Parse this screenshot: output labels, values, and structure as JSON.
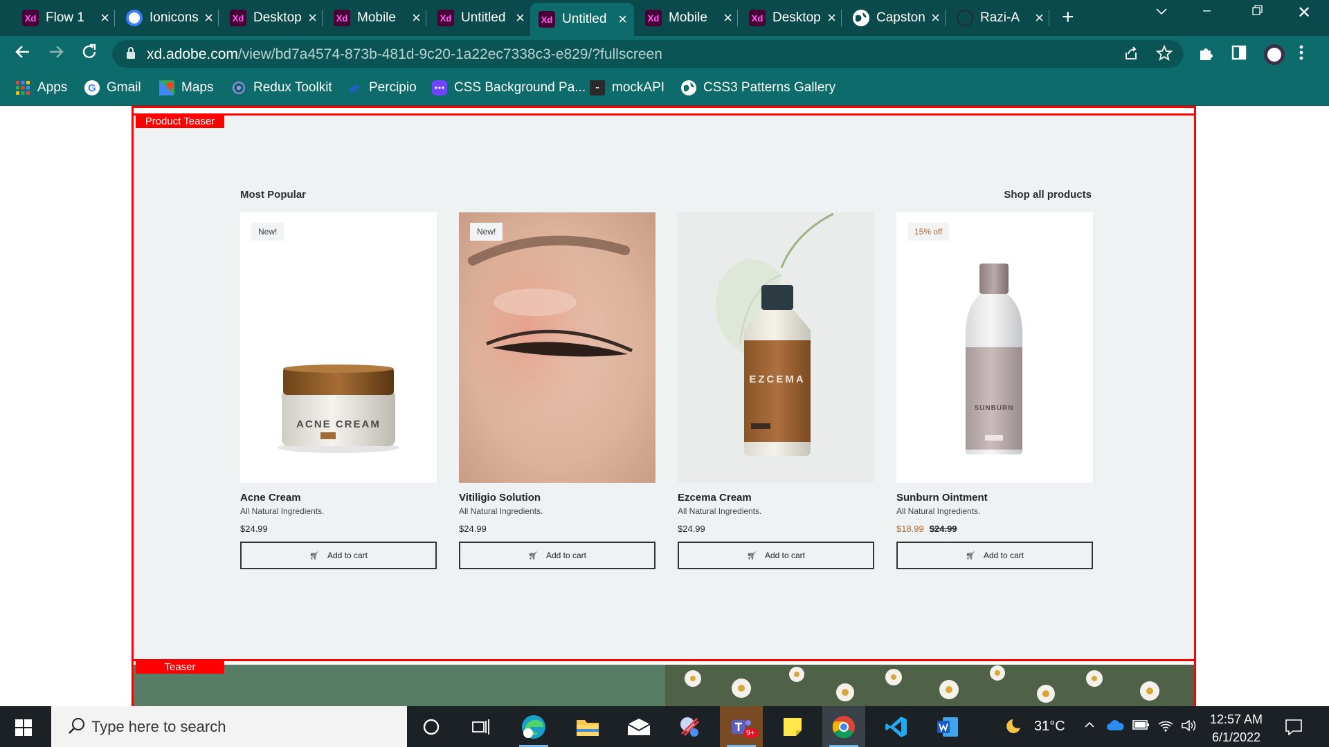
{
  "browser": {
    "tabs": [
      {
        "label": "Flow 1",
        "icon": "xd-icon"
      },
      {
        "label": "Ionicons",
        "icon": "ionicons-icon"
      },
      {
        "label": "Desktop",
        "icon": "xd-icon"
      },
      {
        "label": "Mobile",
        "icon": "xd-icon"
      },
      {
        "label": "Untitled",
        "icon": "xd-icon"
      },
      {
        "label": "Untitled",
        "icon": "xd-icon",
        "active": true
      },
      {
        "label": "Mobile",
        "icon": "xd-icon"
      },
      {
        "label": "Desktop",
        "icon": "xd-icon"
      },
      {
        "label": "Capstone",
        "icon": "globe-icon"
      },
      {
        "label": "Razi-A",
        "icon": "github-icon"
      }
    ],
    "xd_glyph": "Xd",
    "url_host": "xd.adobe.com",
    "url_path": "/view/bd7a4574-873b-481d-9c20-1a22ec7338c3-e829/?fullscreen",
    "bookmarks": [
      {
        "label": "Apps"
      },
      {
        "label": "Gmail"
      },
      {
        "label": "Maps"
      },
      {
        "label": "Redux Toolkit"
      },
      {
        "label": "Percipio"
      },
      {
        "label": "CSS Background Pa..."
      },
      {
        "label": "mockAPI"
      },
      {
        "label": "CSS3 Patterns Gallery"
      }
    ]
  },
  "page": {
    "product_teaser_tag": "Product Teaser",
    "teaser_tag": "Teaser",
    "section_title": "Most Popular",
    "shop_all_link": "Shop all products",
    "products": [
      {
        "name": "Acne Cream",
        "desc": "All Natural Ingredients.",
        "price": "$24.99",
        "sale_price": "",
        "badge": "New!",
        "button": "Add to cart",
        "jar_label": "ACNE CREAM"
      },
      {
        "name": "Vitiligio Solution",
        "desc": "All Natural Ingredients.",
        "price": "$24.99",
        "sale_price": "",
        "badge": "New!",
        "button": "Add to cart"
      },
      {
        "name": "Ezcema Cream",
        "desc": "All Natural Ingredients.",
        "price": "$24.99",
        "sale_price": "",
        "badge": "",
        "button": "Add to cart",
        "bottle_label": "EZCEMA"
      },
      {
        "name": "Sunburn Ointment",
        "desc": "All Natural Ingredients.",
        "price": "$24.99",
        "sale_price": "$18.99",
        "badge": "15% off",
        "button": "Add to cart",
        "bottle_label": "SUNBURN"
      }
    ]
  },
  "taskbar": {
    "search_placeholder": "Type here to search",
    "weather": "31°C",
    "time": "12:57 AM",
    "date": "6/1/2022",
    "teams_badge": "9+"
  },
  "colors": {
    "tab_strip": "#0b4a4c",
    "toolbar": "#0e6b6c",
    "section_bg": "#eef2f3",
    "annotation_red": "#ff0000",
    "sale_accent": "#b06a2e"
  }
}
